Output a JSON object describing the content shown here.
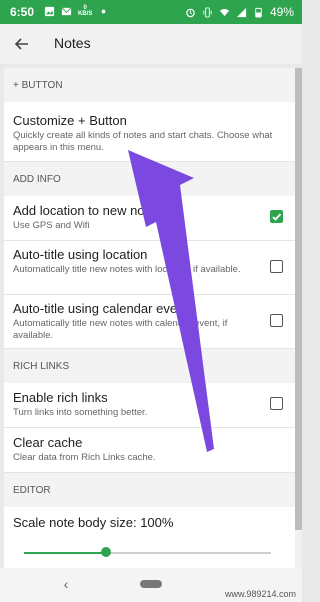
{
  "status_bar": {
    "time": "6:50",
    "left_icons": [
      "image-icon",
      "mail-icon",
      "kbs-icon",
      "dot-icon"
    ],
    "kbs": [
      "0",
      "KB/S"
    ],
    "battery": "49%",
    "right_icons": [
      "alarm-icon",
      "vibrate-icon",
      "wifi-icon",
      "signal-icon",
      "battery-icon"
    ]
  },
  "app_bar": {
    "title": "Notes"
  },
  "sections": [
    {
      "header": "+ BUTTON",
      "rows": [
        {
          "title": "Customize + Button",
          "subtitle": "Quickly create all kinds of notes and start chats. Choose what appears in this menu.",
          "checkbox": null
        }
      ]
    },
    {
      "header": "ADD INFO",
      "rows": [
        {
          "title": "Add location to new notes",
          "subtitle": "Use GPS and Wifi",
          "checkbox": true
        },
        {
          "title": "Auto-title using location",
          "subtitle": "Automatically title new notes with location, if available.",
          "checkbox": false
        },
        {
          "title": "Auto-title using calendar event",
          "subtitle": "Automatically title new notes with calendar event, if available.",
          "checkbox": false
        }
      ]
    },
    {
      "header": "RICH LINKS",
      "rows": [
        {
          "title": "Enable rich links",
          "subtitle": "Turn links into something better.",
          "checkbox": false
        },
        {
          "title": "Clear cache",
          "subtitle": "Clear data from Rich Links cache.",
          "checkbox": null
        }
      ]
    },
    {
      "header": "EDITOR",
      "rows": [
        {
          "title": "Scale note body size: 100%",
          "subtitle": "",
          "checkbox": null
        }
      ]
    }
  ],
  "slider": {
    "value": 0.33
  },
  "watermark": "www.989214.com",
  "colors": {
    "accent": "#2ea44f",
    "arrow": "#7b49e0"
  }
}
